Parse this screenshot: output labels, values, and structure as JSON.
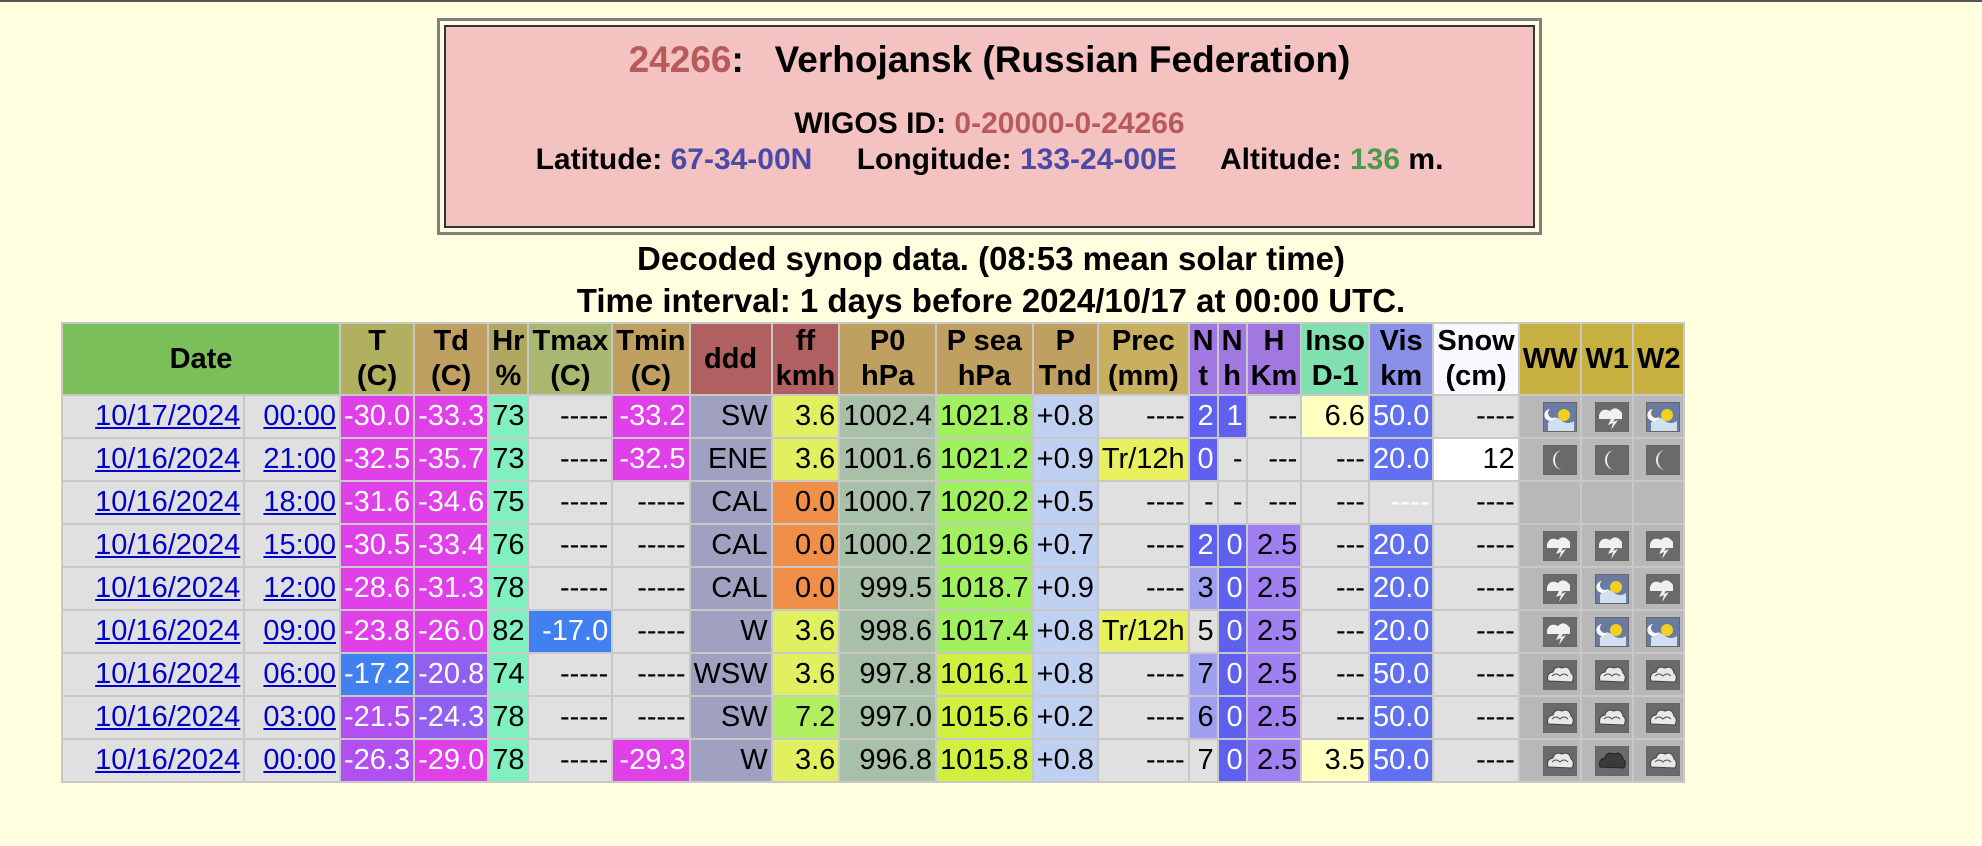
{
  "station": {
    "id": "24266",
    "name_sep": ":",
    "name": "Verhojansk (Russian Federation)",
    "wigos_label": "WIGOS ID:",
    "wigos": "0-20000-0-24266",
    "lat_label": "Latitude:",
    "lat": "67-34-00N",
    "lon_label": "Longitude:",
    "lon": "133-24-00E",
    "alt_label": "Altitude:",
    "alt": "136",
    "alt_unit": "m."
  },
  "heading1": "Decoded synop data. (08:53 mean solar time)",
  "heading2": "Time interval: 1 days before 2024/10/17 at 00:00 UTC.",
  "headers": [
    {
      "l1": "Date",
      "l2": "",
      "bg": "#7abf5a"
    },
    {
      "l1": "T",
      "l2": "(C)",
      "bg": "#b0b060"
    },
    {
      "l1": "Td",
      "l2": "(C)",
      "bg": "#c0a060"
    },
    {
      "l1": "Hr",
      "l2": "%",
      "bg": "#b0a860"
    },
    {
      "l1": "Tmax",
      "l2": "(C)",
      "bg": "#a8b870"
    },
    {
      "l1": "Tmin",
      "l2": "(C)",
      "bg": "#c0a060"
    },
    {
      "l1": "ddd",
      "l2": "",
      "bg": "#b06060"
    },
    {
      "l1": "ff",
      "l2": "kmh",
      "bg": "#b06060"
    },
    {
      "l1": "P0",
      "l2": "hPa",
      "bg": "#c0a060"
    },
    {
      "l1": "P sea",
      "l2": "hPa",
      "bg": "#c0a060"
    },
    {
      "l1": "P",
      "l2": "Tnd",
      "bg": "#c0a060"
    },
    {
      "l1": "Prec",
      "l2": "(mm)",
      "bg": "#c8b060"
    },
    {
      "l1": "N",
      "l2": "t",
      "bg": "#a078e0"
    },
    {
      "l1": "N",
      "l2": "h",
      "bg": "#a078e0"
    },
    {
      "l1": "H",
      "l2": "Km",
      "bg": "#a078e0"
    },
    {
      "l1": "Inso",
      "l2": "D-1",
      "bg": "#80e0b0"
    },
    {
      "l1": "Vis",
      "l2": "km",
      "bg": "#8890e8"
    },
    {
      "l1": "Snow",
      "l2": "(cm)",
      "bg": "#f8f8ff"
    },
    {
      "l1": "WW",
      "l2": "",
      "bg": "#c8b040"
    },
    {
      "l1": "W1",
      "l2": "",
      "bg": "#c8b040"
    },
    {
      "l1": "W2",
      "l2": "",
      "bg": "#c8b040"
    }
  ],
  "colors": {
    "gray": "#e0e0e0",
    "magenta": "#e040e8",
    "purple": "#b050f0",
    "violet": "#9060f0",
    "blue_temp": "#4080f0",
    "hr_mint": "#80f0c0",
    "hr_aqua": "#60f0d8",
    "ddd": "#a0a0c0",
    "ff_yellow": "#e0f060",
    "ff_orange": "#f09048",
    "ff_green": "#b0f060",
    "p0": "#a8c0a8",
    "psea_green": "#a0f060",
    "psea_lime": "#d0f040",
    "ptnd": "#c0d0f0",
    "prec_yellow": "#e8f060",
    "nt_blue": "#6060f0",
    "nt_light": "#a0a0f0",
    "nh": "#6060f0",
    "h": "#a080f0",
    "inso_yellow": "#ffffc0",
    "vis_blue": "#6070f0",
    "white": "#ffffff"
  },
  "rows": [
    {
      "date": "10/17/2024",
      "time": "00:00",
      "cells": [
        [
          "-30.0",
          "magenta"
        ],
        [
          "-33.3",
          "magenta"
        ],
        [
          "73",
          "hr_mint"
        ],
        [
          "-----",
          "gray"
        ],
        [
          "-33.2",
          "magenta"
        ],
        [
          "SW",
          "ddd"
        ],
        [
          "3.6",
          "ff_yellow"
        ],
        [
          "1002.4",
          "p0"
        ],
        [
          "1021.8",
          "psea_green"
        ],
        [
          "+0.8",
          "ptnd"
        ],
        [
          "----",
          "gray"
        ],
        [
          "2",
          "nt_blue"
        ],
        [
          "1",
          "nh"
        ],
        [
          "---",
          "gray"
        ],
        [
          "6.6",
          "inso_yellow"
        ],
        [
          "50.0",
          "vis_blue"
        ],
        [
          "----",
          "gray"
        ]
      ],
      "icons": [
        "moon-sun-icon",
        "storm-night-icon",
        "moon-sun-icon"
      ]
    },
    {
      "date": "10/16/2024",
      "time": "21:00",
      "cells": [
        [
          "-32.5",
          "magenta"
        ],
        [
          "-35.7",
          "magenta"
        ],
        [
          "73",
          "hr_mint"
        ],
        [
          "-----",
          "gray"
        ],
        [
          "-32.5",
          "magenta"
        ],
        [
          "ENE",
          "ddd"
        ],
        [
          "3.6",
          "ff_yellow"
        ],
        [
          "1001.6",
          "p0"
        ],
        [
          "1021.2",
          "psea_green"
        ],
        [
          "+0.9",
          "ptnd"
        ],
        [
          "Tr/12h",
          "prec_yellow"
        ],
        [
          "0",
          "nt_blue"
        ],
        [
          "-",
          "gray"
        ],
        [
          "---",
          "gray"
        ],
        [
          "---",
          "gray"
        ],
        [
          "20.0",
          "vis_blue"
        ],
        [
          "12",
          "white"
        ]
      ],
      "icons": [
        "moon-icon",
        "moon-icon",
        "moon-icon"
      ]
    },
    {
      "date": "10/16/2024",
      "time": "18:00",
      "cells": [
        [
          "-31.6",
          "magenta"
        ],
        [
          "-34.6",
          "magenta"
        ],
        [
          "75",
          "hr_mint"
        ],
        [
          "-----",
          "gray"
        ],
        [
          "-----",
          "gray"
        ],
        [
          "CAL",
          "ddd"
        ],
        [
          "0.0",
          "ff_orange"
        ],
        [
          "1000.7",
          "p0"
        ],
        [
          "1020.2",
          "psea_green"
        ],
        [
          "+0.5",
          "ptnd"
        ],
        [
          "----",
          "gray"
        ],
        [
          "-",
          "gray"
        ],
        [
          "-",
          "gray"
        ],
        [
          "---",
          "gray"
        ],
        [
          "---",
          "gray"
        ],
        [
          "----",
          "gray"
        ],
        [
          "----",
          "gray"
        ]
      ],
      "icons": [
        "",
        "",
        ""
      ]
    },
    {
      "date": "10/16/2024",
      "time": "15:00",
      "cells": [
        [
          "-30.5",
          "magenta"
        ],
        [
          "-33.4",
          "magenta"
        ],
        [
          "76",
          "hr_mint"
        ],
        [
          "-----",
          "gray"
        ],
        [
          "-----",
          "gray"
        ],
        [
          "CAL",
          "ddd"
        ],
        [
          "0.0",
          "ff_orange"
        ],
        [
          "1000.2",
          "p0"
        ],
        [
          "1019.6",
          "psea_green"
        ],
        [
          "+0.7",
          "ptnd"
        ],
        [
          "----",
          "gray"
        ],
        [
          "2",
          "nt_blue"
        ],
        [
          "0",
          "nh"
        ],
        [
          "2.5",
          "h"
        ],
        [
          "---",
          "gray"
        ],
        [
          "20.0",
          "vis_blue"
        ],
        [
          "----",
          "gray"
        ]
      ],
      "icons": [
        "storm-night-icon",
        "storm-night-icon",
        "storm-night-icon"
      ]
    },
    {
      "date": "10/16/2024",
      "time": "12:00",
      "cells": [
        [
          "-28.6",
          "magenta"
        ],
        [
          "-31.3",
          "magenta"
        ],
        [
          "78",
          "hr_mint"
        ],
        [
          "-----",
          "gray"
        ],
        [
          "-----",
          "gray"
        ],
        [
          "CAL",
          "ddd"
        ],
        [
          "0.0",
          "ff_orange"
        ],
        [
          "999.5",
          "p0"
        ],
        [
          "1018.7",
          "psea_green"
        ],
        [
          "+0.9",
          "ptnd"
        ],
        [
          "----",
          "gray"
        ],
        [
          "3",
          "nt_light"
        ],
        [
          "0",
          "nh"
        ],
        [
          "2.5",
          "h"
        ],
        [
          "---",
          "gray"
        ],
        [
          "20.0",
          "vis_blue"
        ],
        [
          "----",
          "gray"
        ]
      ],
      "icons": [
        "storm-night-icon",
        "moon-sun-icon",
        "storm-night-icon"
      ]
    },
    {
      "date": "10/16/2024",
      "time": "09:00",
      "cells": [
        [
          "-23.8",
          "magenta"
        ],
        [
          "-26.0",
          "magenta"
        ],
        [
          "82",
          "hr_mint"
        ],
        [
          "-17.0",
          "blue_temp"
        ],
        [
          "-----",
          "gray"
        ],
        [
          "W",
          "ddd"
        ],
        [
          "3.6",
          "ff_yellow"
        ],
        [
          "998.6",
          "p0"
        ],
        [
          "1017.4",
          "psea_green"
        ],
        [
          "+0.8",
          "ptnd"
        ],
        [
          "Tr/12h",
          "prec_yellow"
        ],
        [
          "5",
          "gray"
        ],
        [
          "0",
          "nh"
        ],
        [
          "2.5",
          "h"
        ],
        [
          "---",
          "gray"
        ],
        [
          "20.0",
          "vis_blue"
        ],
        [
          "----",
          "gray"
        ]
      ],
      "icons": [
        "storm-night-icon",
        "moon-sun-icon",
        "moon-sun-icon"
      ]
    },
    {
      "date": "10/16/2024",
      "time": "06:00",
      "cells": [
        [
          "-17.2",
          "blue_temp"
        ],
        [
          "-20.8",
          "violet"
        ],
        [
          "74",
          "hr_mint"
        ],
        [
          "-----",
          "gray"
        ],
        [
          "-----",
          "gray"
        ],
        [
          "WSW",
          "ddd"
        ],
        [
          "3.6",
          "ff_yellow"
        ],
        [
          "997.8",
          "p0"
        ],
        [
          "1016.1",
          "psea_lime"
        ],
        [
          "+0.8",
          "ptnd"
        ],
        [
          "----",
          "gray"
        ],
        [
          "7",
          "nt_light"
        ],
        [
          "0",
          "nh"
        ],
        [
          "2.5",
          "h"
        ],
        [
          "---",
          "gray"
        ],
        [
          "50.0",
          "vis_blue"
        ],
        [
          "----",
          "gray"
        ]
      ],
      "icons": [
        "cloud-icon",
        "cloud-icon",
        "cloud-icon"
      ]
    },
    {
      "date": "10/16/2024",
      "time": "03:00",
      "cells": [
        [
          "-21.5",
          "purple"
        ],
        [
          "-24.3",
          "violet"
        ],
        [
          "78",
          "hr_mint"
        ],
        [
          "-----",
          "gray"
        ],
        [
          "-----",
          "gray"
        ],
        [
          "SW",
          "ddd"
        ],
        [
          "7.2",
          "ff_green"
        ],
        [
          "997.0",
          "p0"
        ],
        [
          "1015.6",
          "psea_lime"
        ],
        [
          "+0.2",
          "ptnd"
        ],
        [
          "----",
          "gray"
        ],
        [
          "6",
          "nt_light"
        ],
        [
          "0",
          "nh"
        ],
        [
          "2.5",
          "h"
        ],
        [
          "---",
          "gray"
        ],
        [
          "50.0",
          "vis_blue"
        ],
        [
          "----",
          "gray"
        ]
      ],
      "icons": [
        "cloud-icon",
        "cloud-icon",
        "cloud-icon"
      ]
    },
    {
      "date": "10/16/2024",
      "time": "00:00",
      "cells": [
        [
          "-26.3",
          "purple"
        ],
        [
          "-29.0",
          "magenta"
        ],
        [
          "78",
          "hr_mint"
        ],
        [
          "-----",
          "gray"
        ],
        [
          "-29.3",
          "magenta"
        ],
        [
          "W",
          "ddd"
        ],
        [
          "3.6",
          "ff_yellow"
        ],
        [
          "996.8",
          "p0"
        ],
        [
          "1015.8",
          "psea_lime"
        ],
        [
          "+0.8",
          "ptnd"
        ],
        [
          "----",
          "gray"
        ],
        [
          "7",
          "gray"
        ],
        [
          "0",
          "nh"
        ],
        [
          "2.5",
          "h"
        ],
        [
          "3.5",
          "inso_yellow"
        ],
        [
          "50.0",
          "vis_blue"
        ],
        [
          "----",
          "gray"
        ]
      ],
      "icons": [
        "cloud-icon",
        "dark-cloud-icon",
        "cloud-icon"
      ]
    }
  ]
}
